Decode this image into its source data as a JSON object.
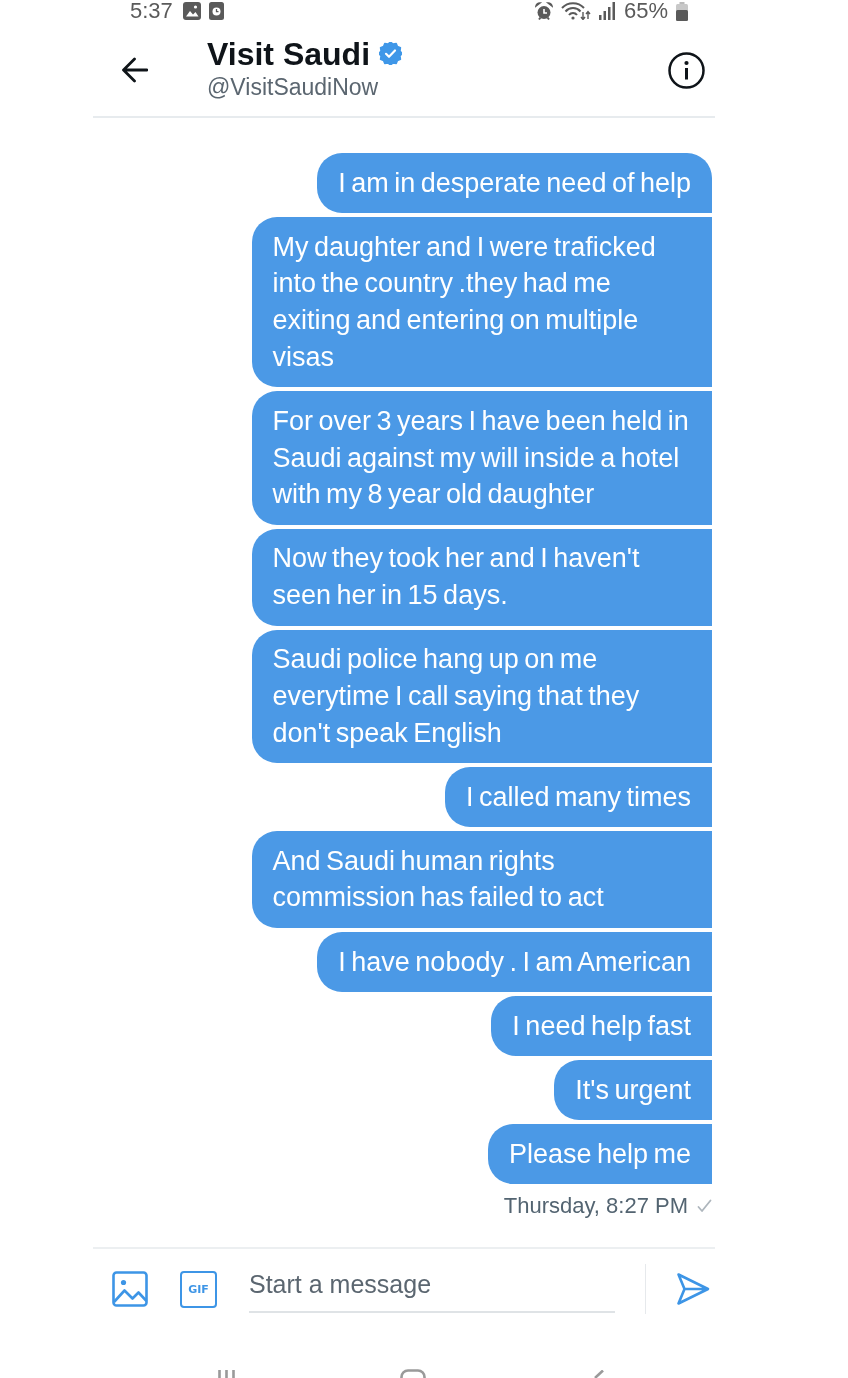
{
  "status_bar": {
    "time": "5:37",
    "battery_text": "65%"
  },
  "header": {
    "title": "Visit Saudi",
    "verified": true,
    "handle": "@VisitSaudiNow"
  },
  "messages": [
    "I am in desperate need of help",
    "My daughter and I were traficked into the country .they had me exiting and entering on multiple visas",
    "For over 3 years I have been held in Saudi against my will inside a hotel with my 8 year old daughter",
    "Now they took her and I haven't seen her in 15 days.",
    "Saudi police hang up on me everytime I call saying that they don't speak English",
    "I called many times",
    "And Saudi human rights commission has failed to act",
    "I have nobody . I am American",
    "I need help fast",
    "It's urgent",
    "Please help me"
  ],
  "timestamp": "Thursday, 8:27 PM",
  "composer": {
    "gif_label": "GIF",
    "placeholder": "Start a message"
  }
}
